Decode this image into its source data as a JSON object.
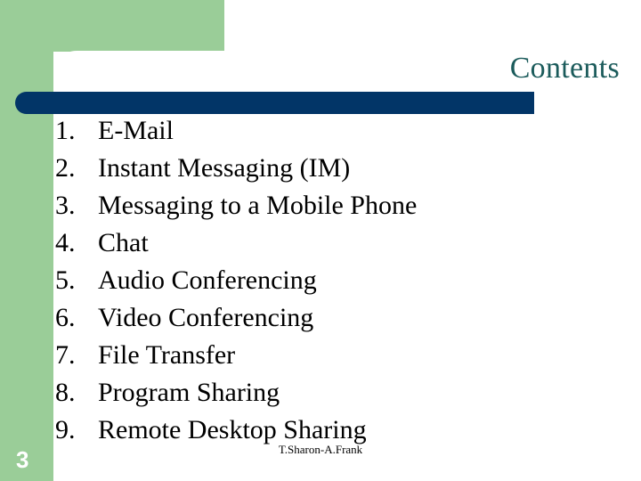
{
  "slide": {
    "title": "Contents",
    "page_number": "3",
    "footer_credit": "T.Sharon-A.Frank",
    "colors": {
      "accent_green": "#9acd98",
      "rule_navy": "#023567",
      "title_teal": "#1b5b5b",
      "body_text": "#000000",
      "background": "#ffffff"
    },
    "items": [
      {
        "number": "1.",
        "label": "E-Mail"
      },
      {
        "number": "2.",
        "label": "Instant Messaging (IM)"
      },
      {
        "number": "3.",
        "label": "Messaging to a Mobile Phone"
      },
      {
        "number": "4.",
        "label": "Chat"
      },
      {
        "number": "5.",
        "label": "Audio Conferencing"
      },
      {
        "number": "6.",
        "label": "Video Conferencing"
      },
      {
        "number": "7.",
        "label": "File Transfer"
      },
      {
        "number": "8.",
        "label": "Program Sharing"
      },
      {
        "number": "9.",
        "label": "Remote Desktop Sharing"
      }
    ]
  }
}
